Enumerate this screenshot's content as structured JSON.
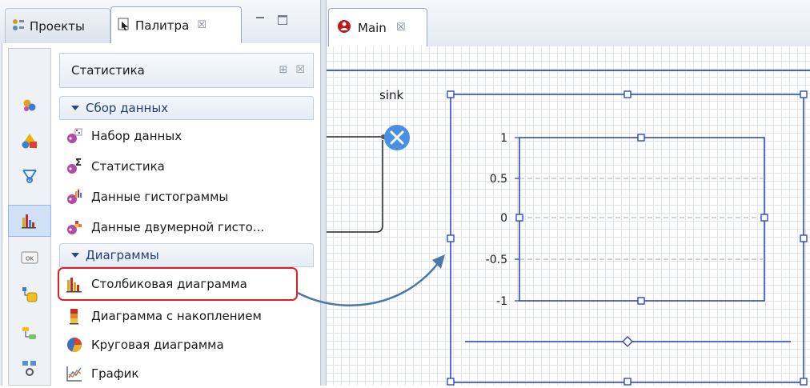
{
  "left_panel": {
    "tabs": [
      {
        "label": "Проекты",
        "icon": "projects-icon"
      },
      {
        "label": "Палитра",
        "icon": "palette-icon",
        "close": "☒"
      }
    ],
    "window_controls": {
      "minimize": "minimize-icon",
      "maximize": "maximize-icon"
    }
  },
  "palette": {
    "section_title": "Статистика",
    "section_tools": [
      "⊞",
      "☒"
    ],
    "categories": [
      "agent-icon",
      "shapes-icon",
      "network-icon",
      "statistics-icon",
      "ok-control-icon",
      "database-icon",
      "connectivity-icon",
      "process-icon"
    ],
    "groups": [
      {
        "title": "Сбор данных",
        "items": [
          {
            "label": "Набор данных",
            "icon": "dataset-icon"
          },
          {
            "label": "Статистика",
            "icon": "statistics-sigma-icon"
          },
          {
            "label": "Данные гистограммы",
            "icon": "histogram-data-icon"
          },
          {
            "label": "Данные двумерной гисто...",
            "icon": "2d-histogram-data-icon"
          }
        ]
      },
      {
        "title": "Диаграммы",
        "items": [
          {
            "label": "Столбиковая диаграмма",
            "icon": "bar-chart-icon",
            "highlighted": true
          },
          {
            "label": "Диаграмма с накоплением",
            "icon": "stack-chart-icon"
          },
          {
            "label": "Круговая диаграмма",
            "icon": "pie-chart-icon"
          },
          {
            "label": "График",
            "icon": "plot-icon"
          }
        ]
      }
    ]
  },
  "editor": {
    "tab_label": "Main",
    "tab_close": "☒",
    "sink_label": "sink",
    "chart": {
      "y_ticks": [
        "1",
        "0.5",
        "0",
        "-0.5",
        "-1"
      ]
    }
  },
  "colors": {
    "selection_blue": "#1f3fbf",
    "highlight_red": "#e02020",
    "arrow_blue": "#4a78a8",
    "sink_blue": "#4a90e2"
  }
}
